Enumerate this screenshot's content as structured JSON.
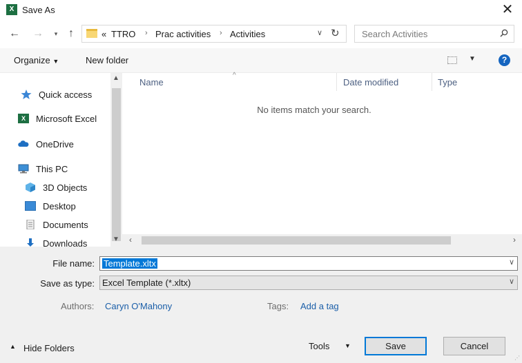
{
  "window": {
    "title": "Save As",
    "app_icon_text": "X"
  },
  "nav": {
    "breadcrumb": {
      "overflow": "«",
      "items": [
        "TTRO",
        "Prac activities",
        "Activities"
      ]
    },
    "search_placeholder": "Search Activities"
  },
  "toolbar": {
    "organize": "Organize",
    "new_folder": "New folder"
  },
  "sidebar": {
    "items": [
      {
        "label": "Quick access",
        "icon": "star-icon"
      },
      {
        "label": "Microsoft Excel",
        "icon": "excel-icon"
      },
      {
        "label": "OneDrive",
        "icon": "cloud-icon"
      },
      {
        "label": "This PC",
        "icon": "computer-icon"
      },
      {
        "label": "3D Objects",
        "icon": "cube-icon"
      },
      {
        "label": "Desktop",
        "icon": "desktop-icon"
      },
      {
        "label": "Documents",
        "icon": "document-icon"
      },
      {
        "label": "Downloads",
        "icon": "download-icon"
      }
    ]
  },
  "filelist": {
    "columns": [
      "Name",
      "Date modified",
      "Type"
    ],
    "empty_message": "No items match your search."
  },
  "form": {
    "file_name_label": "File name:",
    "file_name_value": "Template.xltx",
    "save_type_label": "Save as type:",
    "save_type_value": "Excel Template (*.xltx)",
    "authors_label": "Authors:",
    "authors_value": "Caryn O'Mahony",
    "tags_label": "Tags:",
    "tags_value": "Add a tag"
  },
  "footer": {
    "hide_folders": "Hide Folders",
    "tools": "Tools",
    "save": "Save",
    "cancel": "Cancel"
  },
  "colors": {
    "accent": "#0078d7",
    "link": "#1a5ea8",
    "excel_green": "#1d6f42"
  }
}
